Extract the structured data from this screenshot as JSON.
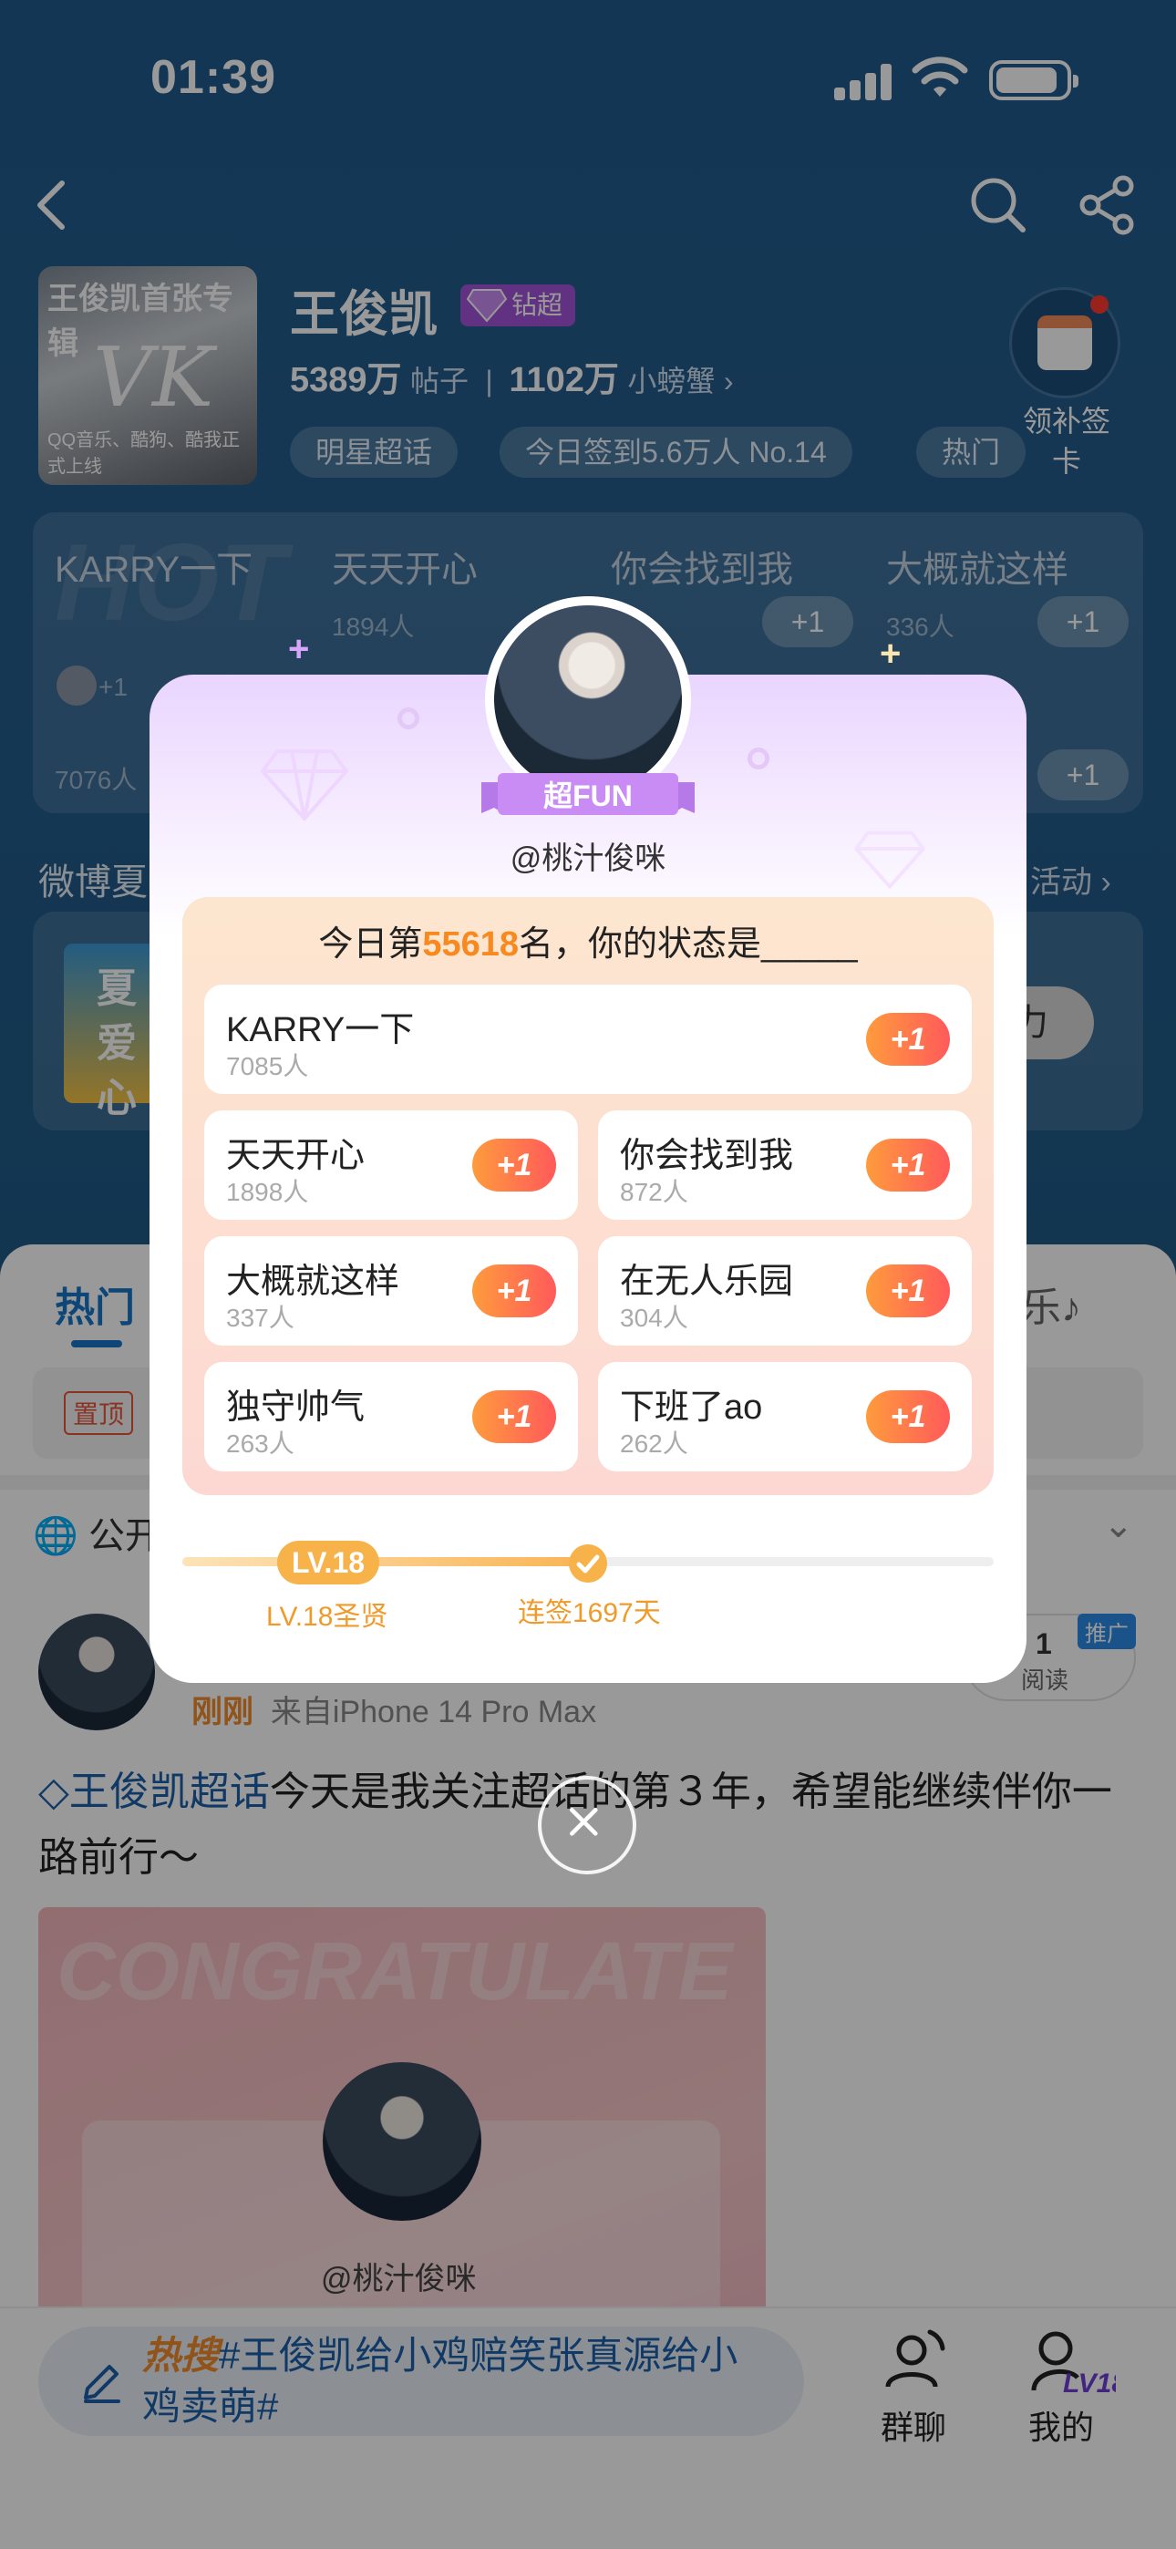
{
  "status_bar": {
    "time": "01:39"
  },
  "profile": {
    "cover_title": "王俊凯首张专辑",
    "cover_sub": "QQ音乐、酷狗、酷我正式上线",
    "name": "王俊凯",
    "badge": "钻超",
    "posts_count": "5389万",
    "posts_label": "帖子",
    "fans_count": "1102万",
    "fans_label": "小螃蟹",
    "chips": [
      "明星超话",
      "今日签到5.6万人 No.14",
      "热门"
    ],
    "sign_label": "领补签卡"
  },
  "bg_grid": {
    "hot": "HOT",
    "cells": [
      {
        "title": "KARRY一下",
        "count": "7076人"
      },
      {
        "title": "天天开心",
        "count": "1894人"
      },
      {
        "title": "你会找到我",
        "count": ""
      },
      {
        "title": "大概就这样",
        "count": "336人"
      }
    ],
    "plus": "+1",
    "avatar_plus": "+1"
  },
  "bg_weibo": {
    "label": "微博夏",
    "activity": "活动 ›",
    "banner_text": "夏 爱心",
    "banner_btn": "力"
  },
  "tabs": {
    "hot": "热门",
    "music": "乐♪"
  },
  "pinned_tag": "置顶",
  "public_label": "公开",
  "post": {
    "time": "刚刚",
    "source": "来自iPhone 14 Pro Max",
    "read_count": "1",
    "read_label": "阅读",
    "promo": "推广",
    "topic": "王俊凯超话",
    "text": "今天是我关注超话的第３年，希望能继续伴你一路前行～",
    "image_congrats": "CONGRATULATE",
    "image_handle": "@桃汁俊咪"
  },
  "bottom_bar": {
    "compose_hot": "热搜",
    "compose_text": "#王俊凯给小鸡赔笑张真源给小鸡卖萌#",
    "chat_label": "群聊",
    "me_label": "我的",
    "me_level": "LV18"
  },
  "modal": {
    "ribbon": "超FUN",
    "handle": "@桃汁俊咪",
    "rank_prefix": "今日第",
    "rank_number": "55618",
    "rank_suffix": "名，你的状态是_____",
    "plus_label": "+1",
    "options": [
      {
        "title": "KARRY一下",
        "count": "7085人"
      },
      {
        "title": "天天开心",
        "count": "1898人"
      },
      {
        "title": "你会找到我",
        "count": "872人"
      },
      {
        "title": "大概就这样",
        "count": "337人"
      },
      {
        "title": "在无人乐园",
        "count": "304人"
      },
      {
        "title": "独守帅气",
        "count": "263人"
      },
      {
        "title": "下班了ao",
        "count": "262人"
      }
    ],
    "level_pill": "LV.18",
    "level_label": "LV.18圣贤",
    "streak_label": "连签1697天"
  },
  "colors": {
    "accent": "#f7891f",
    "link": "#1b5fa8",
    "plus_start": "#ff9b3d",
    "plus_end": "#ff5a5a",
    "badge": "#a254d8"
  }
}
